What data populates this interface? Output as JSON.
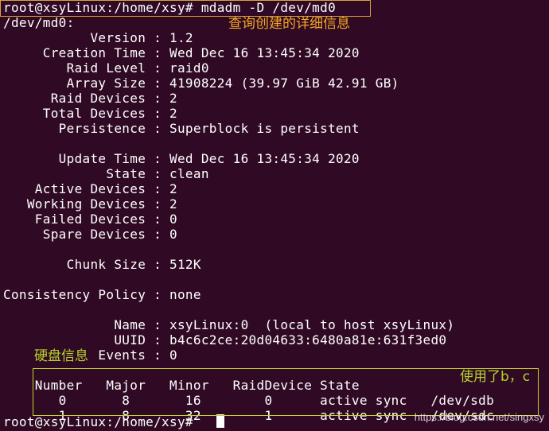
{
  "terminal": {
    "lines": [
      "root@xsyLinux:/home/xsy# mdadm -D /dev/md0",
      "/dev/md0:",
      "           Version : 1.2",
      "     Creation Time : Wed Dec 16 13:45:34 2020",
      "        Raid Level : raid0",
      "        Array Size : 41908224 (39.97 GiB 42.91 GB)",
      "      Raid Devices : 2",
      "     Total Devices : 2",
      "       Persistence : Superblock is persistent",
      "",
      "       Update Time : Wed Dec 16 13:45:34 2020",
      "             State : clean",
      "    Active Devices : 2",
      "   Working Devices : 2",
      "    Failed Devices : 0",
      "     Spare Devices : 0",
      "",
      "        Chunk Size : 512K",
      "",
      "Consistency Policy : none",
      "",
      "              Name : xsyLinux:0  (local to host xsyLinux)",
      "              UUID : b4c6c2ce:20d04633:6480a81e:631f3ed0",
      "            Events : 0",
      "",
      "    Number   Major   Minor   RaidDevice State",
      "       0       8       16        0      active sync   /dev/sdb",
      "       1       8       32        1      active sync   /dev/sdc",
      "root@xsyLinux:/home/xsy# "
    ]
  },
  "annotations": {
    "query_note": "查询创建的详细信息",
    "disk_info_note": "硬盘信息",
    "used_note": "使用了b，c"
  },
  "watermark": "https://blog.csdn.net/singxsy",
  "colors": {
    "background": "#300a24",
    "text": "#ffffff",
    "note_orange": "#f5a623",
    "note_green": "#b7d32a",
    "box_orange": "#d8a33c",
    "box_green": "#c6d42a"
  }
}
